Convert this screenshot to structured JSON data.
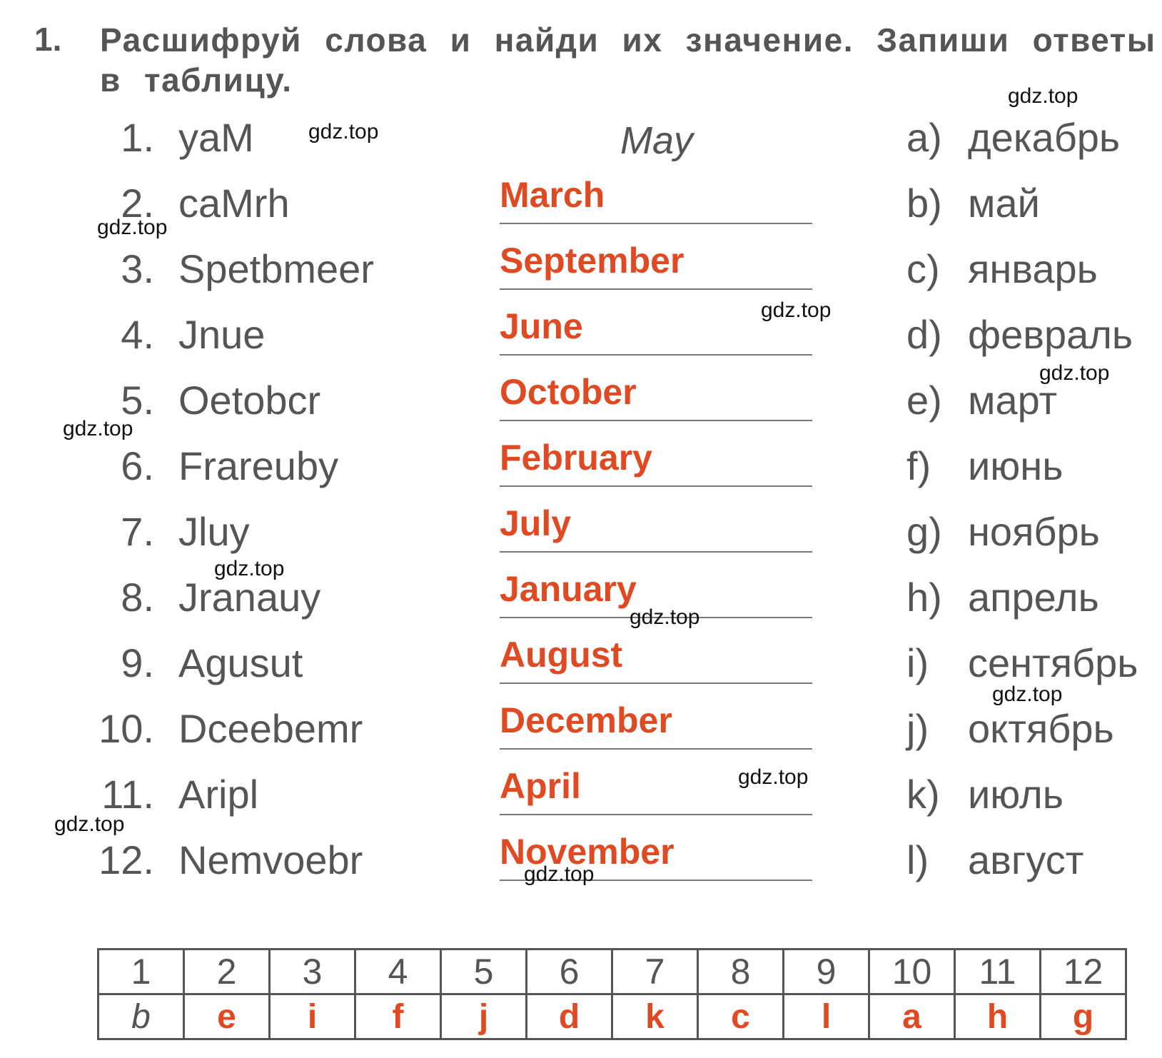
{
  "task": {
    "number": "1.",
    "instruction": "Расшифруй слова и найди их значение. Запиши ответы в таблицу."
  },
  "colors": {
    "answer": "#e04a22",
    "print": "#555555"
  },
  "items": [
    {
      "num": "1.",
      "scrambled": "yaM",
      "answer": "May",
      "sample": true
    },
    {
      "num": "2.",
      "scrambled": "caMrh",
      "answer": "March"
    },
    {
      "num": "3.",
      "scrambled": "Spetbmeer",
      "answer": "September"
    },
    {
      "num": "4.",
      "scrambled": "Jnue",
      "answer": "June"
    },
    {
      "num": "5.",
      "scrambled": "Oetobcr",
      "answer": "October"
    },
    {
      "num": "6.",
      "scrambled": "Frareuby",
      "answer": "February"
    },
    {
      "num": "7.",
      "scrambled": "Jluy",
      "answer": "July"
    },
    {
      "num": "8.",
      "scrambled": "Jranauy",
      "answer": "January"
    },
    {
      "num": "9.",
      "scrambled": "Agusut",
      "answer": "August"
    },
    {
      "num": "10.",
      "scrambled": "Dceebemr",
      "answer": "December"
    },
    {
      "num": "11.",
      "scrambled": "Aripl",
      "answer": "April"
    },
    {
      "num": "12.",
      "scrambled": "Nemvoebr",
      "answer": "November"
    }
  ],
  "options": [
    {
      "letter": "a)",
      "text": "декабрь"
    },
    {
      "letter": "b)",
      "text": "май"
    },
    {
      "letter": "c)",
      "text": "январь"
    },
    {
      "letter": "d)",
      "text": "февраль"
    },
    {
      "letter": "e)",
      "text": "март"
    },
    {
      "letter": "f)",
      "text": "июнь"
    },
    {
      "letter": "g)",
      "text": "ноябрь"
    },
    {
      "letter": "h)",
      "text": "апрель"
    },
    {
      "letter": "i)",
      "text": "сентябрь"
    },
    {
      "letter": "j)",
      "text": "октябрь"
    },
    {
      "letter": "k)",
      "text": "июль"
    },
    {
      "letter": "l)",
      "text": "август"
    }
  ],
  "answer_table": {
    "headers": [
      "1",
      "2",
      "3",
      "4",
      "5",
      "6",
      "7",
      "8",
      "9",
      "10",
      "11",
      "12"
    ],
    "answers": [
      "b",
      "e",
      "i",
      "f",
      "j",
      "d",
      "k",
      "c",
      "l",
      "a",
      "h",
      "g"
    ]
  },
  "watermark": "gdz.top"
}
